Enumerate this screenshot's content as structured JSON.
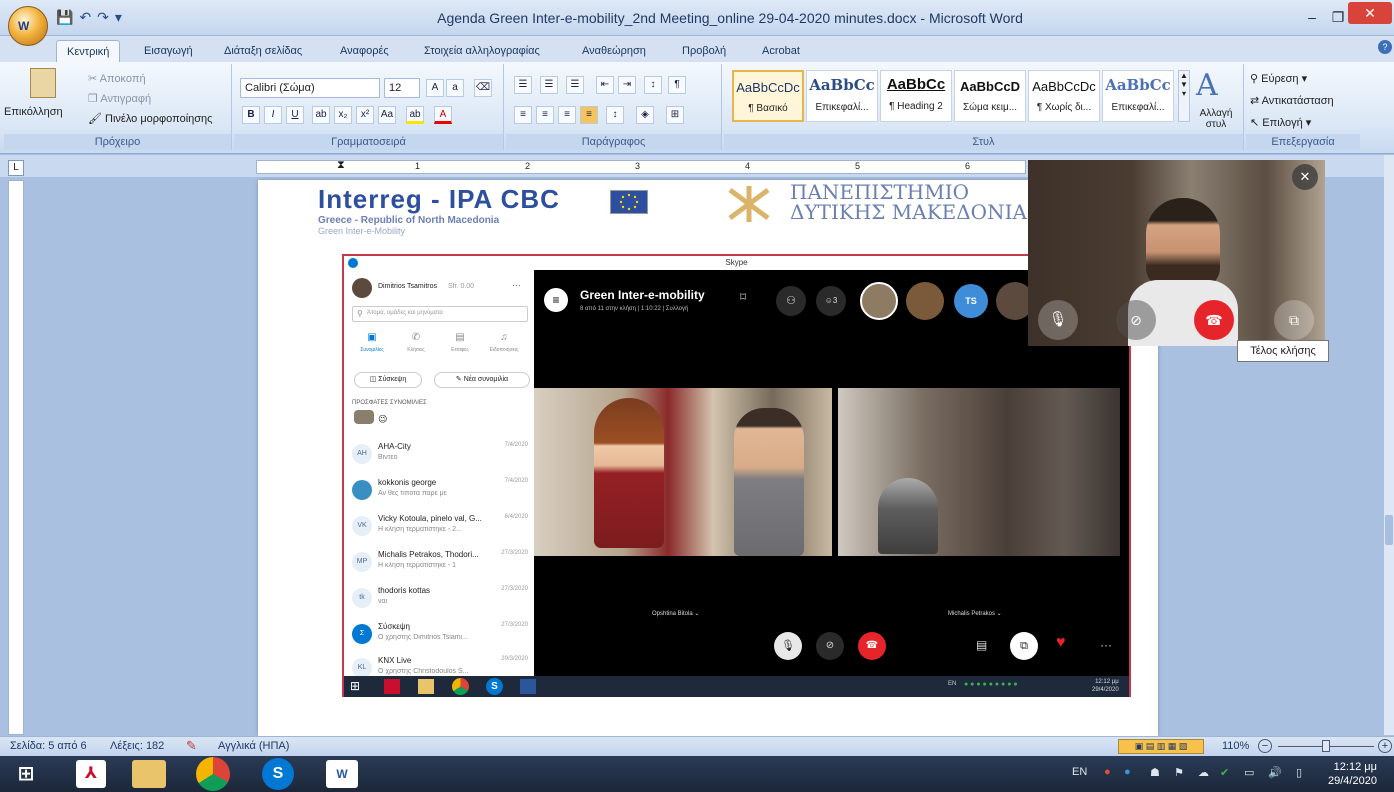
{
  "window": {
    "title": "Agenda Green Inter-e-mobility_2nd Meeting_online 29-04-2020 minutes.docx - Microsoft Word",
    "minimize": "–",
    "restore": "❐",
    "close": "✕"
  },
  "qat": {
    "save": "💾",
    "undo": "↶",
    "redo": "↷",
    "more": "▾"
  },
  "tabs": [
    "Κεντρική",
    "Εισαγωγή",
    "Διάταξη σελίδας",
    "Αναφορές",
    "Στοιχεία αλληλογραφίας",
    "Αναθεώρηση",
    "Προβολή",
    "Acrobat"
  ],
  "ribbon": {
    "clipboard": {
      "label": "Πρόχειρο",
      "paste": "Επικόλληση",
      "cut": "Αποκοπή",
      "copy": "Αντιγραφή",
      "format_painter": "Πινέλο μορφοποίησης"
    },
    "font": {
      "label": "Γραμματοσειρά",
      "font_name": "Calibri (Σώμα)",
      "font_size": "12"
    },
    "paragraph": {
      "label": "Παράγραφος"
    },
    "styles": {
      "label": "Στυλ",
      "items": [
        {
          "sample": "AaBbCcDc",
          "name": "¶ Βασικό"
        },
        {
          "sample": "AaBbCc",
          "name": "Επικεφαλί..."
        },
        {
          "sample": "AaBbCc",
          "name": "¶ Heading 2"
        },
        {
          "sample": "AaBbCcD",
          "name": "Σώμα κειμ..."
        },
        {
          "sample": "AaBbCcDc",
          "name": "¶ Χωρίς δι..."
        },
        {
          "sample": "AaBbCc",
          "name": "Επικεφαλί..."
        }
      ],
      "change_styles": "Αλλαγή στυλ"
    },
    "editing": {
      "label": "Επεξεργασία",
      "find": "Εύρεση",
      "replace": "Αντικατάσταση",
      "select": "Επιλογή"
    }
  },
  "ruler": {
    "marks": [
      "1",
      "2",
      "3",
      "4",
      "5",
      "6"
    ]
  },
  "document": {
    "logo_line1": "Interreg - IPA CBC",
    "logo_line2": "Greece - Republic of North Macedonia",
    "logo_line3": "Green Inter-e-Mobility",
    "uni_line1": "ΠΑΝΕΠΙΣΤΗΜΙΟ",
    "uni_line2": "ΔΥΤΙΚΗΣ ΜΑΚΕΔΟΝΙΑ"
  },
  "skype": {
    "window_title": "Skype",
    "user": "Dimitrios Tsamitros",
    "balance": "Sfr. 0.00",
    "search_placeholder": "Άτομα, ομάδες και μηνύματα",
    "nav": [
      "Συνομιλίες",
      "Κλήσεις",
      "Επαφές",
      "Ειδοποιήσεις"
    ],
    "meet_button": "Σύσκεψη",
    "new_chat_button": "Νέα συνομιλία",
    "recent_header": "ΠΡΟΣΦΑΤΕΣ ΣΥΝΟΜΙΛΙΕΣ",
    "conversations": [
      {
        "initials": "AH",
        "name": "AHA-City",
        "message": "Βίντεο",
        "date": "7/4/2020"
      },
      {
        "initials": "KG",
        "name": "kokkonis george",
        "message": "Αν θες τιποτα παρε με",
        "date": "7/4/2020"
      },
      {
        "initials": "VK",
        "name": "Vicky Kotoula, pinelo val, G...",
        "message": "Η κλήση τερματίστηκε - 2...",
        "date": "6/4/2020"
      },
      {
        "initials": "MP",
        "name": "Michalis Petrakos, Thodori...",
        "message": "Η κλήση τερματίστηκε - 1",
        "date": "27/3/2020"
      },
      {
        "initials": "tk",
        "name": "thodoris kottas",
        "message": "ναι",
        "date": "27/3/2020"
      },
      {
        "initials": "Σ",
        "name": "Σύσκεψη",
        "message": "Ο χρήστης Dimitrios Tsiami...",
        "date": "27/3/2020"
      },
      {
        "initials": "KL",
        "name": "KNX Live",
        "message": "Ο χρήστης Christodoulos S...",
        "date": "20/3/2020"
      }
    ],
    "call_title": "Green Inter-e-mobility",
    "call_subtitle": "8 από 11 στην κλήση | 1:10:22 | Συλλογή",
    "participant_count": "3",
    "ts_badge": "TS",
    "tile_left_name": "Opshtina Bitola",
    "tile_right_name": "Michalis Petrakos",
    "taskbar_lang": "EN",
    "taskbar_time": "12:12 μμ",
    "taskbar_date": "29/4/2020"
  },
  "callwin": {
    "end_call_tooltip": "Τέλος κλήσης"
  },
  "statusbar": {
    "page": "Σελίδα: 5 από 6",
    "words": "Λέξεις: 182",
    "language": "Αγγλικά (ΗΠΑ)",
    "zoom": "110%"
  },
  "taskbar": {
    "lang": "EN",
    "time": "12:12 μμ",
    "date": "29/4/2020"
  },
  "colors": {
    "accent": "#2b579a",
    "end_call": "#e5252a",
    "skype_blue": "#0078d4"
  }
}
